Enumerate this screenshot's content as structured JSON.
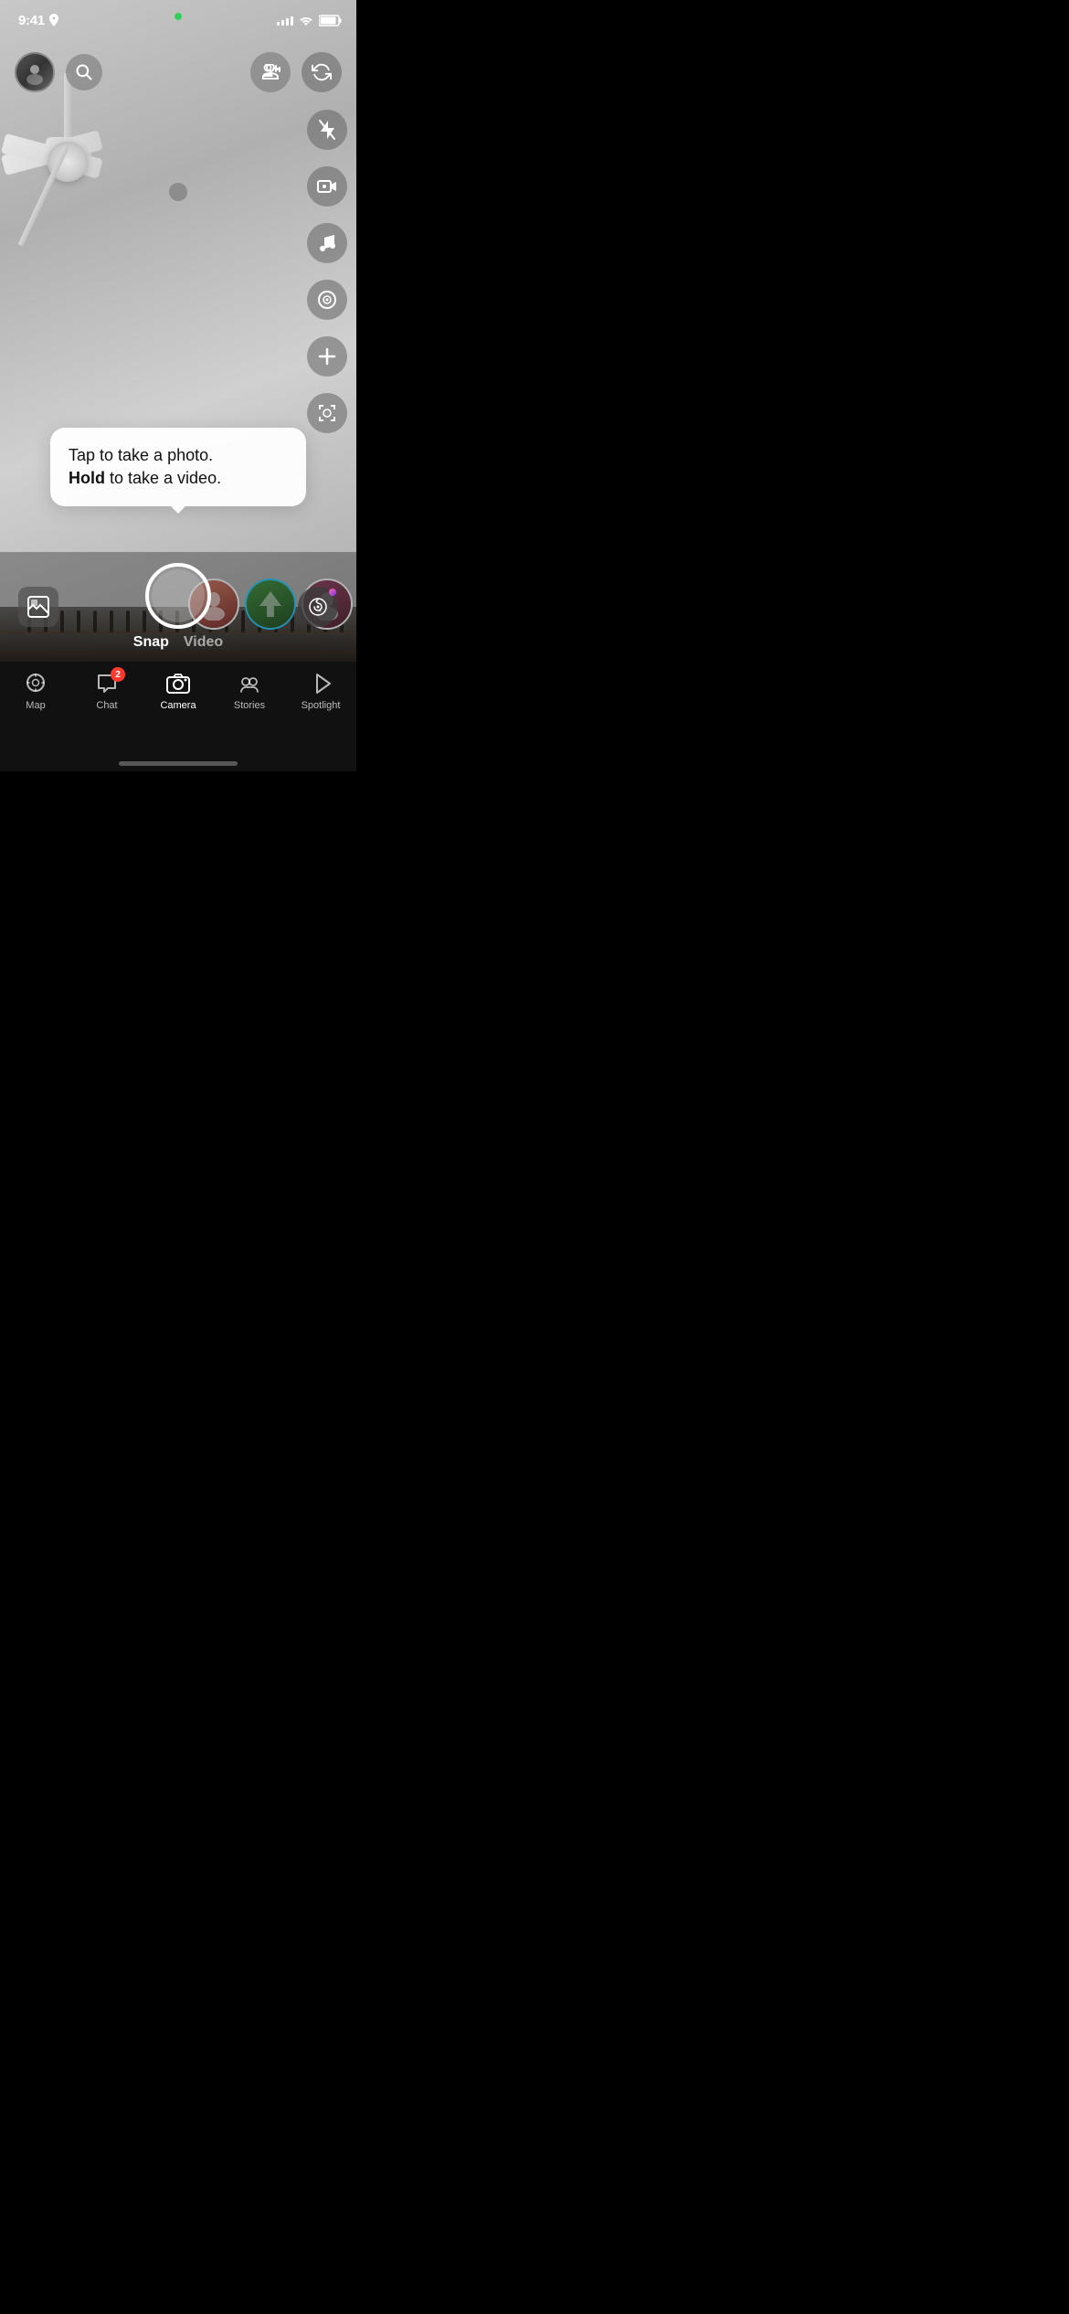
{
  "statusBar": {
    "time": "9:41",
    "locationIcon": "▶",
    "signalBars": [
      3,
      5,
      7,
      9,
      11
    ],
    "wifiStrength": 3,
    "batteryLevel": 85
  },
  "topBar": {
    "searchLabel": "Search",
    "addFriendLabel": "Add Friend",
    "flipCameraLabel": "Flip Camera"
  },
  "rightSidebar": {
    "flashOffLabel": "Flash Off",
    "liveLabel": "Live",
    "musicLabel": "Music",
    "lensLabel": "Lens",
    "addLabel": "Add",
    "scanLabel": "Scan"
  },
  "tooltip": {
    "line1": "Tap to take a photo.",
    "line2": "Hold",
    "line2b": " to take a video."
  },
  "cameraBar": {
    "galleryLabel": "Gallery",
    "snapLabel": "Snap",
    "videoLabel": "Video",
    "aiLabel": "AI"
  },
  "bottomNav": {
    "items": [
      {
        "id": "map",
        "label": "Map",
        "icon": "map"
      },
      {
        "id": "chat",
        "label": "Chat",
        "icon": "chat",
        "badge": "2"
      },
      {
        "id": "camera",
        "label": "Camera",
        "icon": "camera",
        "active": true
      },
      {
        "id": "stories",
        "label": "Stories",
        "icon": "stories"
      },
      {
        "id": "spotlight",
        "label": "Spotlight",
        "icon": "spotlight"
      }
    ]
  },
  "colors": {
    "accent": "#FFFC00",
    "danger": "#ff3b30",
    "navBg": "#111111",
    "activeNav": "#FFFFFF"
  }
}
